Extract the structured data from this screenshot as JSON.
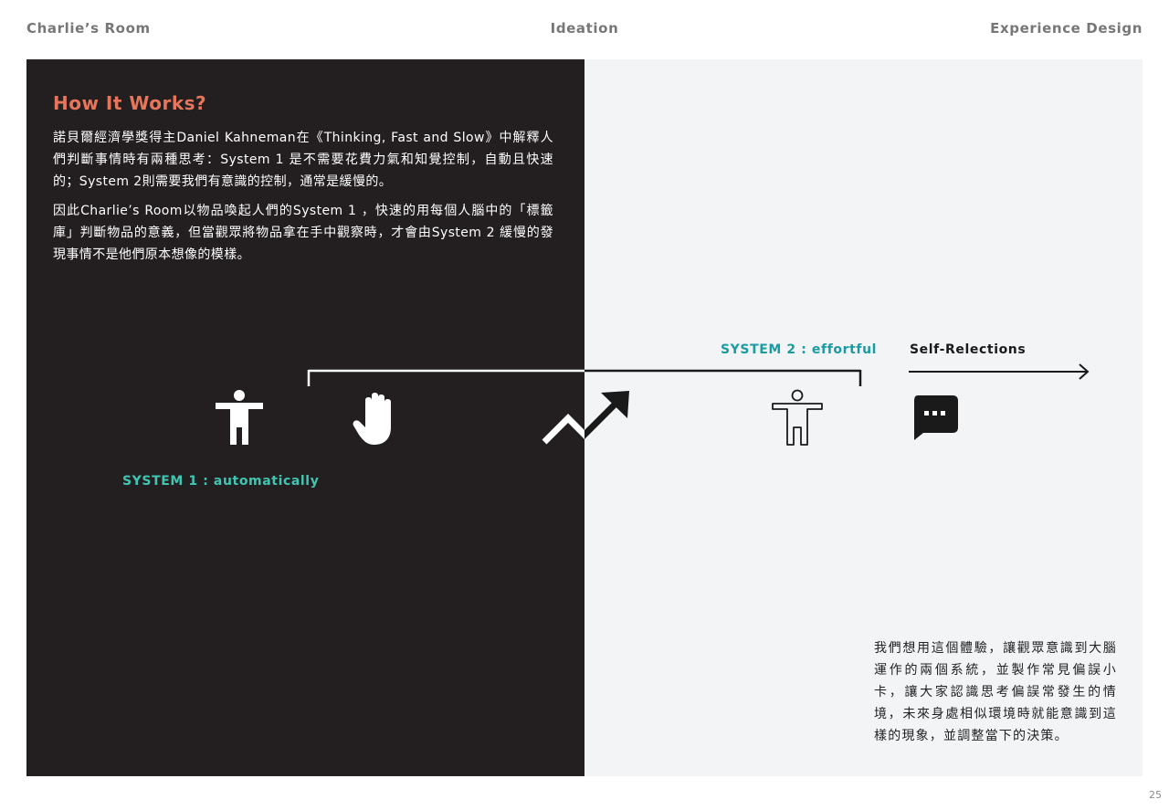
{
  "header": {
    "left": "Charlie’s Room",
    "center": "Ideation",
    "right": "Experience Design"
  },
  "left_panel": {
    "title": "How It Works?",
    "paragraph1": "諾貝爾經濟學獎得主Daniel Kahneman在《Thinking, Fast and Slow》中解釋人們判斷事情時有兩種思考：System 1 是不需要花費力氣和知覺控制，自動且快速的；System 2則需要我們有意識的控制，通常是緩慢的。",
    "paragraph2": "因此Charlie’s Room以物品喚起人們的System 1 ，快速的用每個人腦中的「標籤庫」判斷物品的意義，但當觀眾將物品拿在手中觀察時，才會由System 2 緩慢的發現事情不是他們原本想像的模樣。"
  },
  "diagram": {
    "system1_label": "SYSTEM 1 : automatically",
    "system2_label": "SYSTEM 2 : effortful",
    "self_reflection_label": "Self-Relections",
    "icons": [
      "person-icon",
      "hand-icon",
      "trend-up-arrow-icon",
      "person-outline-icon",
      "chat-bubble-icon"
    ]
  },
  "right_panel": {
    "closing_text": "我們想用這個體驗，讓觀眾意識到大腦運作的兩個系統，並製作常見偏誤小卡，讓大家認識思考偏誤常發生的情境，未來身處相似環境時就能意識到這樣的現象，並調整當下的決策。"
  },
  "page_number": "25",
  "colors": {
    "dark_panel": "#231f20",
    "light_panel": "#f2f4f6",
    "title_accent": "#e6755a",
    "system1": "#3fc6b2",
    "system2": "#1a9ba3"
  }
}
